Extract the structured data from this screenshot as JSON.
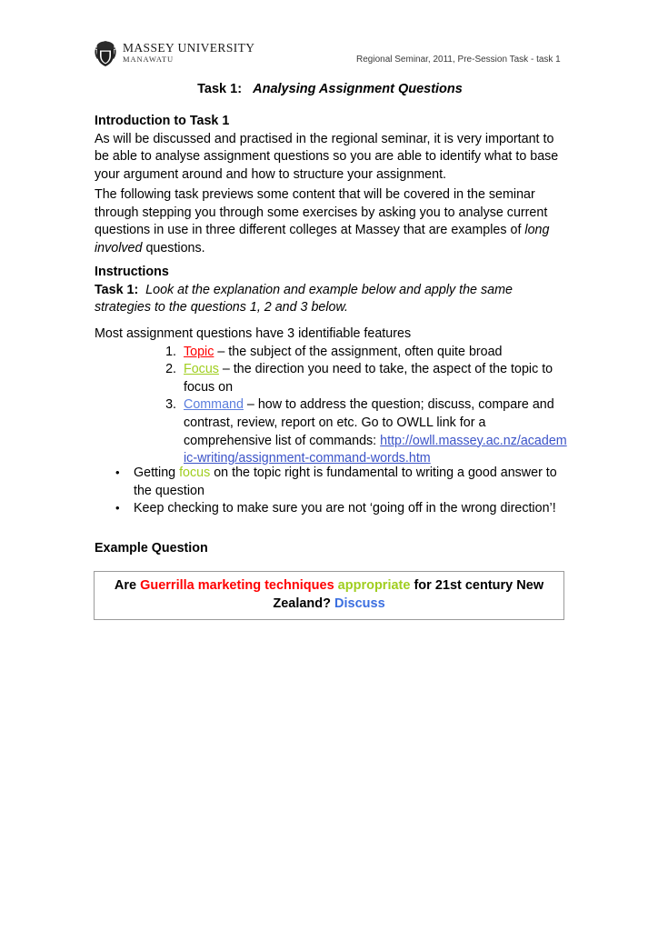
{
  "header": {
    "logo_name": "MASSEY UNIVERSITY",
    "logo_campus": "MANAWATU",
    "logo_icon": "massey-crest-icon",
    "right_text": "Regional Seminar, 2011, Pre-Session Task  - task 1"
  },
  "title": {
    "prefix": "Task 1:",
    "italic": "Analysing Assignment Questions"
  },
  "intro": {
    "heading": "Introduction to Task 1",
    "body": "As will be discussed and practised in the regional seminar, it is very important to be able to analyse assignment questions so you are able to identify what to base your argument around and how to structure your assignment."
  },
  "preview": {
    "part1": "The following task previews some content that will be covered in the seminar through stepping you through some exercises by asking you to analyse current questions in use in three different colleges at Massey that are examples of ",
    "italic": "long involved",
    "part2": " questions."
  },
  "instructions": {
    "heading": "Instructions",
    "task_label": "Task 1:",
    "task_italic": "Look at the explanation and example below and apply the same strategies to the questions 1, 2 and 3 below."
  },
  "features": {
    "lead": "Most assignment questions have 3 identifiable features",
    "items": [
      {
        "num": "1.",
        "keyword": "Topic",
        "keyword_color": "#ff0000",
        "text": " – the subject of the assignment, often quite broad"
      },
      {
        "num": "2.",
        "keyword": "Focus",
        "keyword_color": "#a0ce20",
        "text": " – the direction you need to take, the aspect of the topic to focus on"
      },
      {
        "num": "3.",
        "keyword": "Command",
        "keyword_color": "#5a7ddd",
        "text": " – how to address the question; discuss, compare and contrast, review, report on etc. Go to OWLL link for a comprehensive list of commands:",
        "link": "http://owll.massey.ac.nz/academic-writing/assignment-command-words.htm"
      }
    ]
  },
  "tips": {
    "bullet_glyph": "•",
    "items": [
      {
        "before": "Getting ",
        "highlight": "focus",
        "highlight_color": "#a0ce20",
        "after": " on the topic right is fundamental to writing a good answer to the question"
      },
      {
        "before": "Keep checking to make sure you are not ‘going off in the wrong direction’!",
        "highlight": "",
        "after": ""
      }
    ]
  },
  "example": {
    "heading": "Example Question",
    "segments": [
      {
        "text": "Are ",
        "color": "#000000"
      },
      {
        "text": "Guerrilla marketing techniques",
        "color": "#ff0000"
      },
      {
        "text": " ",
        "color": "#000000"
      },
      {
        "text": "appropriate",
        "color": "#a0ce20"
      },
      {
        "text": " for 21st century New Zealand? ",
        "color": "#000000"
      },
      {
        "text": " Discuss",
        "color": "#3b6fe0"
      }
    ],
    "full_text": "Are Guerrilla marketing techniques appropriate for 21st century New Zealand?  Discuss"
  }
}
